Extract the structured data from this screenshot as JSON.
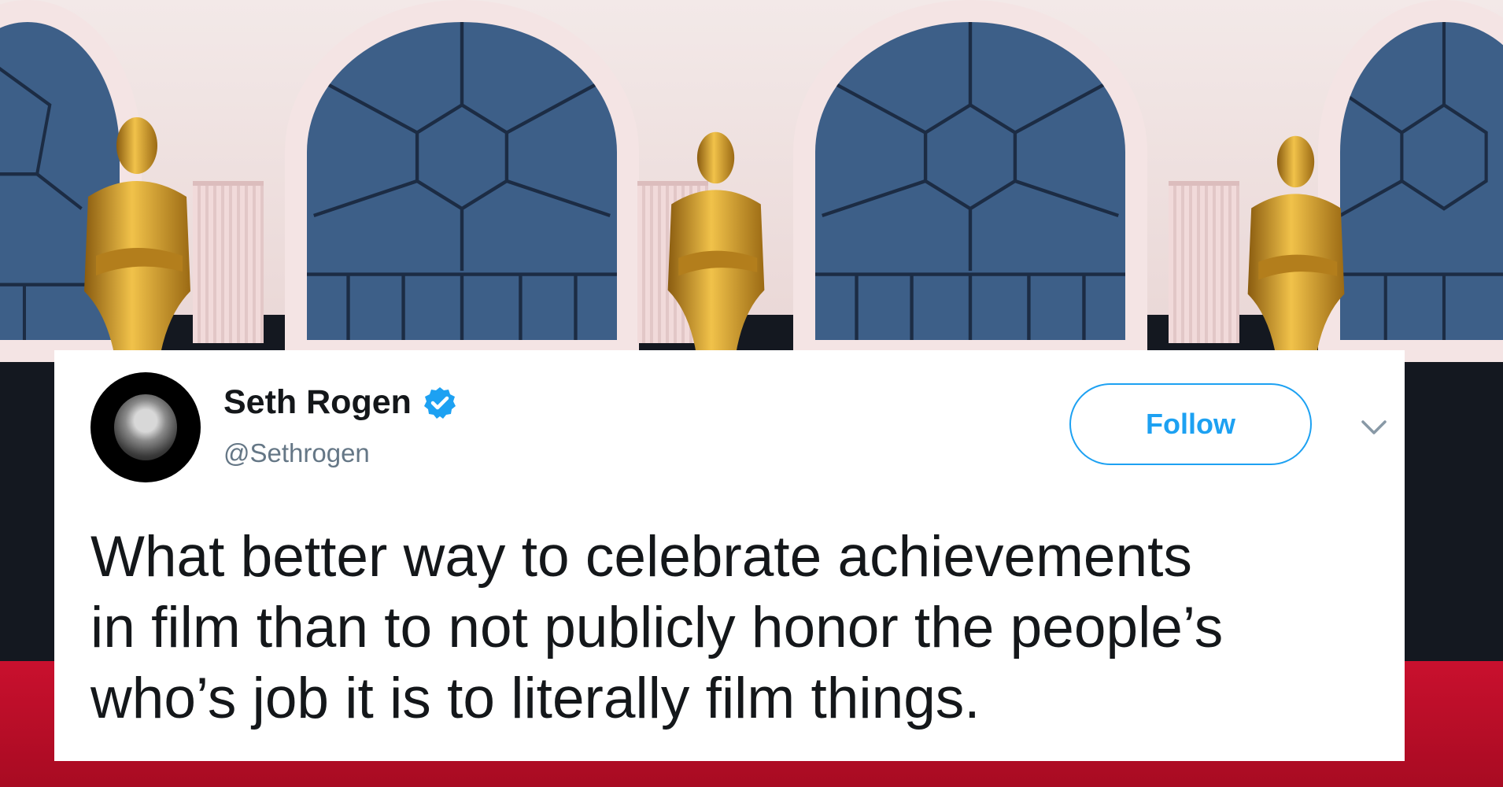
{
  "tweet": {
    "display_name": "Seth Rogen",
    "handle": "@Sethrogen",
    "verified": true,
    "follow_label": "Follow",
    "text_lines": [
      "What better way to celebrate achievements",
      "in film than to not publicly honor the people’s",
      "who’s job it is to literally film things."
    ]
  },
  "icons": {
    "verified": "verified-badge-icon",
    "menu": "chevron-down-icon",
    "avatar": "profile-avatar"
  },
  "colors": {
    "brand_blue": "#1da1f2",
    "name_text": "#14171a",
    "handle_text": "#657786",
    "carpet_red": "#c9102e"
  }
}
